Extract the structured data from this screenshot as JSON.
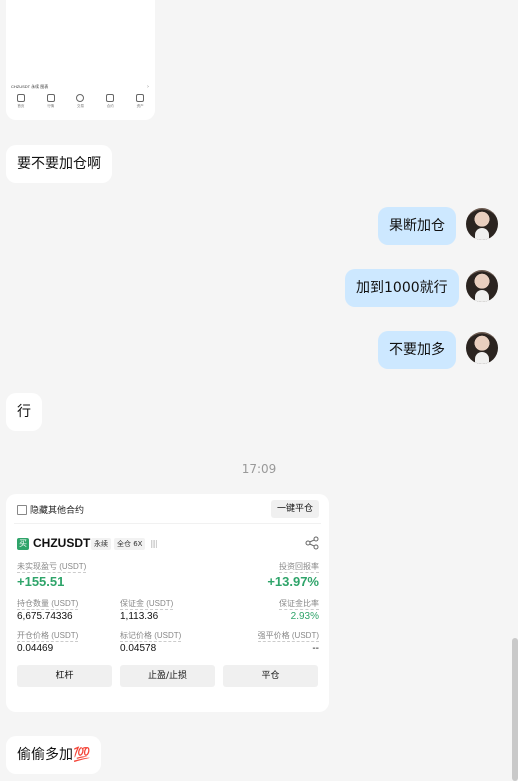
{
  "top_card": {
    "pair": "CHZUSDT 永续 图表",
    "chevron": "›",
    "nav": [
      "首页",
      "行情",
      "交易",
      "合约",
      "资产"
    ]
  },
  "messages": [
    {
      "side": "left",
      "text": "要不要加仓啊"
    },
    {
      "side": "right",
      "text": "果断加仓"
    },
    {
      "side": "right",
      "text": "加到1000就行"
    },
    {
      "side": "right",
      "text": "不要加多"
    },
    {
      "side": "left",
      "text": "行"
    },
    {
      "side": "left",
      "text": "偷偷多加💯"
    }
  ],
  "timestamp": "17:09",
  "position": {
    "hide_other": "隐藏其他合约",
    "close_all": "一键平仓",
    "coin_icon": "买",
    "symbol": "CHZUSDT",
    "tag_type": "永续",
    "tag_margin": "全仓 6X",
    "bars": "||||",
    "unrealized_label": "未实现盈亏 (USDT)",
    "unrealized_value": "+155.51",
    "roi_label": "投资回报率",
    "roi_value": "+13.97%",
    "qty_label": "持仓数量 (USDT)",
    "qty_value": "6,675.74336",
    "margin_label": "保证金 (USDT)",
    "margin_value": "1,113.36",
    "ratio_label": "保证金比率",
    "ratio_value": "2.93%",
    "entry_label": "开仓价格 (USDT)",
    "entry_value": "0.04469",
    "mark_label": "标记价格 (USDT)",
    "mark_value": "0.04578",
    "liq_label": "强平价格 (USDT)",
    "liq_value": "--",
    "btn_leverage": "杠杆",
    "btn_tpsl": "止盈/止损",
    "btn_close": "平仓"
  },
  "colors": {
    "accent_green": "#2fa46a",
    "bubble_right": "#cde8ff"
  }
}
